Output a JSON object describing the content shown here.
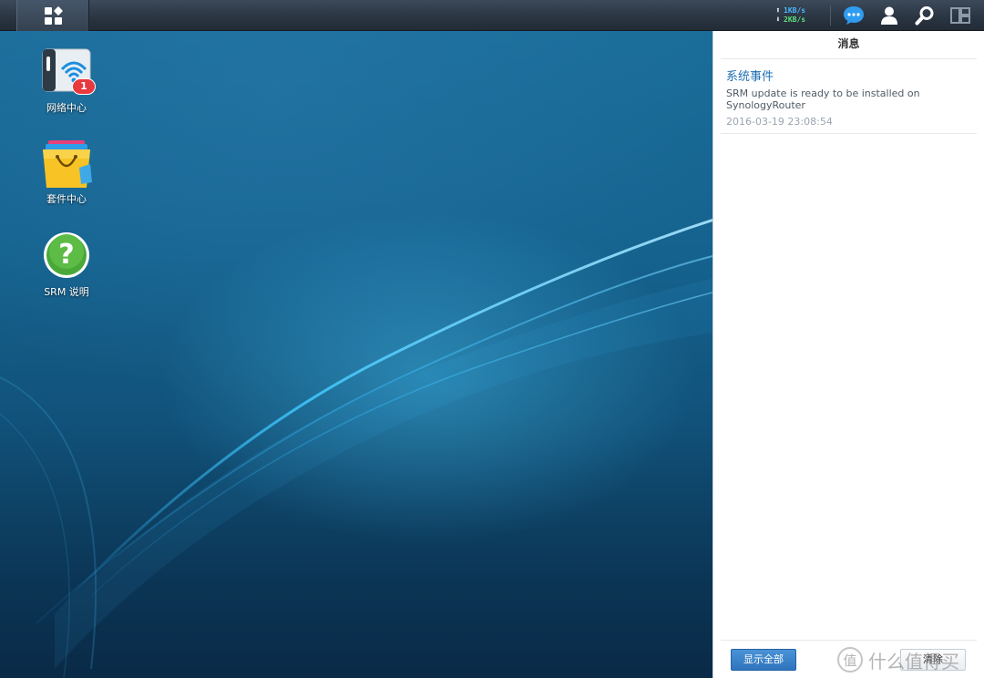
{
  "taskbar": {
    "main_menu_icon": "grid-menu-icon",
    "upload_speed": "1KB/s",
    "download_speed": "2KB/s",
    "icons": [
      "notification-icon",
      "user-icon",
      "search-icon",
      "widgets-icon"
    ]
  },
  "desktop": {
    "icons": [
      {
        "label": "网络中心",
        "icon": "wifi-router-icon",
        "badge": "1"
      },
      {
        "label": "套件中心",
        "icon": "package-bag-icon"
      },
      {
        "label": "SRM 说明",
        "icon": "help-icon"
      }
    ]
  },
  "notifications_panel": {
    "title": "消息",
    "items": [
      {
        "category": "系统事件",
        "message": "SRM update is ready to be installed on SynologyRouter",
        "time": "2016-03-19 23:08:54"
      }
    ],
    "show_all_label": "显示全部",
    "clear_label": "清除"
  },
  "watermark": {
    "glyph": "值",
    "text": "什么值得买"
  },
  "colors": {
    "taskbar": "#2b3643",
    "accent": "#1e6fb4",
    "badge": "#e8393e",
    "upload": "#4cb8ff",
    "download": "#5fe07a"
  }
}
